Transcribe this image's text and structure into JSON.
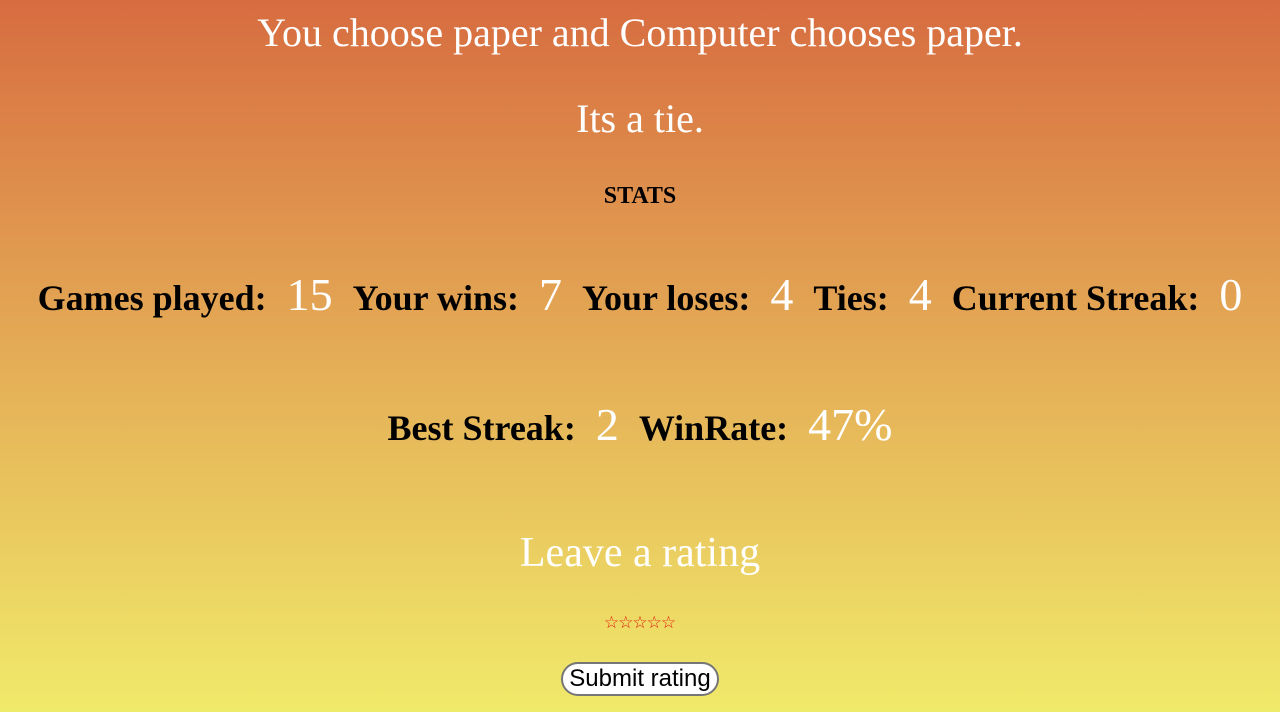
{
  "result": {
    "choice_text": "You choose paper and Computer chooses paper.",
    "outcome_text": "Its a tie."
  },
  "stats": {
    "title": "STATS",
    "games_played": {
      "label": "Games played:",
      "value": "15"
    },
    "wins": {
      "label": "Your wins:",
      "value": "7"
    },
    "loses": {
      "label": "Your loses:",
      "value": "4"
    },
    "ties": {
      "label": "Ties:",
      "value": "4"
    },
    "current_streak": {
      "label": "Current Streak:",
      "value": "0"
    },
    "best_streak": {
      "label": "Best Streak:",
      "value": "2"
    },
    "win_rate": {
      "label": "WinRate:",
      "value": "47%"
    }
  },
  "rating": {
    "heading": "Leave a rating",
    "stars": [
      "☆",
      "☆",
      "☆",
      "☆",
      "☆"
    ],
    "selected": 0,
    "submit_label": "Submit rating"
  },
  "colors": {
    "gradient_top": "#d76c40",
    "gradient_bottom": "#f0ea6a",
    "value_text": "#ffffff",
    "label_text": "#000000",
    "star": "#e21b0c"
  }
}
